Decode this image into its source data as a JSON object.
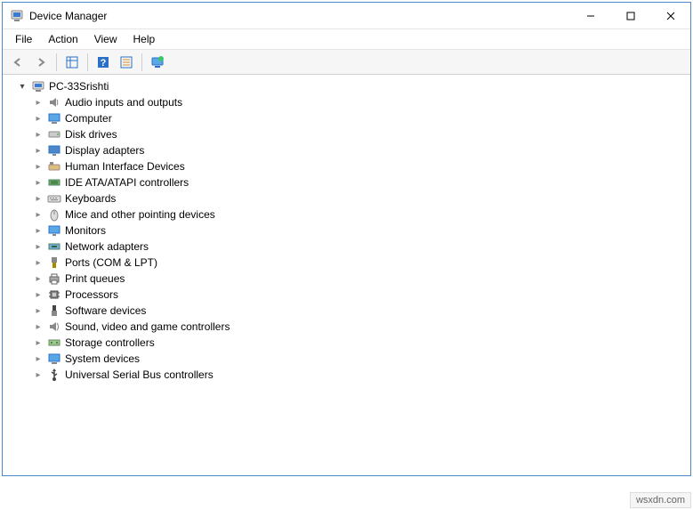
{
  "window": {
    "title": "Device Manager"
  },
  "menubar": {
    "items": [
      {
        "label": "File"
      },
      {
        "label": "Action"
      },
      {
        "label": "View"
      },
      {
        "label": "Help"
      }
    ]
  },
  "tree": {
    "root": {
      "label": "PC-33Srishti"
    },
    "categories": [
      {
        "label": "Audio inputs and outputs",
        "icon": "audio"
      },
      {
        "label": "Computer",
        "icon": "computer"
      },
      {
        "label": "Disk drives",
        "icon": "disk"
      },
      {
        "label": "Display adapters",
        "icon": "display"
      },
      {
        "label": "Human Interface Devices",
        "icon": "hid"
      },
      {
        "label": "IDE ATA/ATAPI controllers",
        "icon": "ide"
      },
      {
        "label": "Keyboards",
        "icon": "keyboard"
      },
      {
        "label": "Mice and other pointing devices",
        "icon": "mouse"
      },
      {
        "label": "Monitors",
        "icon": "monitor"
      },
      {
        "label": "Network adapters",
        "icon": "network"
      },
      {
        "label": "Ports (COM & LPT)",
        "icon": "port"
      },
      {
        "label": "Print queues",
        "icon": "printer"
      },
      {
        "label": "Processors",
        "icon": "cpu"
      },
      {
        "label": "Software devices",
        "icon": "software"
      },
      {
        "label": "Sound, video and game controllers",
        "icon": "sound"
      },
      {
        "label": "Storage controllers",
        "icon": "storage"
      },
      {
        "label": "System devices",
        "icon": "system"
      },
      {
        "label": "Universal Serial Bus controllers",
        "icon": "usb"
      }
    ]
  },
  "footer": {
    "watermark": "wsxdn.com"
  }
}
